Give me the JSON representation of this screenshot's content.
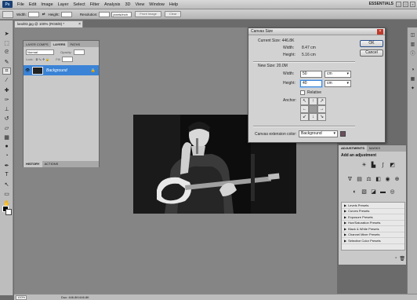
{
  "menubar": {
    "logo": "Ps",
    "items": [
      "File",
      "Edit",
      "Image",
      "Layer",
      "Select",
      "Filter",
      "Analysis",
      "3D",
      "View",
      "Window",
      "Help"
    ],
    "workspace": "ESSENTIALS"
  },
  "options": {
    "width_label": "Width:",
    "height_label": "Height:",
    "resolution_label": "Resolution:",
    "resolution_unit": "pixels/inch",
    "front_image": "Front Image",
    "clear": "Clear"
  },
  "document": {
    "tab_title": "land03.jpg @ 100% (RGB/8) *",
    "zoom": "100%",
    "doc_size": "Doc: 446.8K/446.8K"
  },
  "layers_panel": {
    "tabs": [
      "LAYER COMPS",
      "LAYERS",
      "PATHS"
    ],
    "active_tab": "LAYERS",
    "blend_mode": "Normal",
    "opacity_label": "Opacity:",
    "lock_label": "Lock:",
    "fill_label": "Fill:",
    "layer_name": "Background",
    "bottom_tabs": [
      "HISTORY",
      "ACTIONS"
    ]
  },
  "canvas_dialog": {
    "title": "Canvas Size",
    "current_size_label": "Current Size: 446.8K",
    "width_label": "Width:",
    "height_label": "Height:",
    "current_width": "8.47 cm",
    "current_height": "5.16 cm",
    "new_size_label": "New Size: 20.0M",
    "new_width": "50",
    "new_height": "40",
    "unit": "cm",
    "relative_label": "Relative",
    "anchor_label": "Anchor:",
    "extension_label": "Canvas extension color:",
    "extension_value": "Background",
    "ok": "OK",
    "cancel": "Cancel"
  },
  "adjustments": {
    "tabs": [
      "ADJUSTMENTS",
      "MASKS"
    ],
    "active_tab": "ADJUSTMENTS",
    "heading": "Add an adjustment",
    "presets": [
      "Levels Presets",
      "Curves Presets",
      "Exposure Presets",
      "Hue/Saturation Presets",
      "Black & White Presets",
      "Channel Mixer Presets",
      "Selective Color Presets"
    ]
  },
  "colors": {
    "selection_blue": "#3a83d6",
    "extension_swatch": "#6b4f5f"
  }
}
